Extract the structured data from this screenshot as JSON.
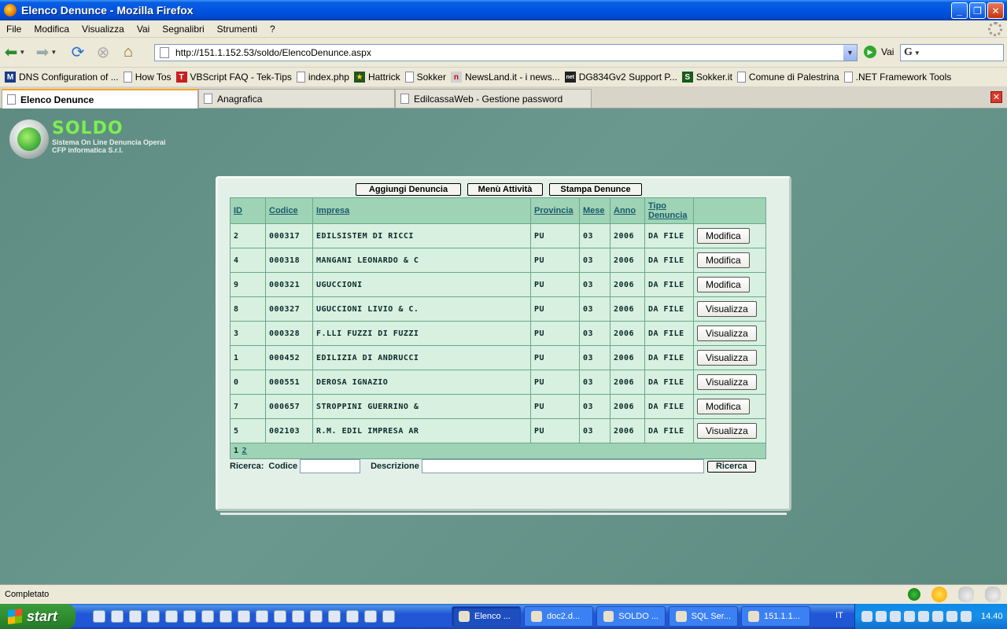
{
  "window": {
    "title": "Elenco Denunce - Mozilla Firefox"
  },
  "menu": [
    "File",
    "Modifica",
    "Visualizza",
    "Vai",
    "Segnalibri",
    "Strumenti",
    "?"
  ],
  "nav": {
    "url": "http://151.1.152.53/soldo/ElencoDenunce.aspx",
    "go_label": "Vai",
    "search_engine_icon": "google-icon"
  },
  "bookmarks": [
    {
      "label": "DNS Configuration of ...",
      "icon": "m"
    },
    {
      "label": "How Tos",
      "icon": "page"
    },
    {
      "label": "VBScript FAQ - Tek-Tips",
      "icon": "red"
    },
    {
      "label": "index.php",
      "icon": "page"
    },
    {
      "label": "Hattrick",
      "icon": "star"
    },
    {
      "label": "Sokker",
      "icon": "page"
    },
    {
      "label": "NewsLand.it - i news...",
      "icon": "nl"
    },
    {
      "label": "DG834Gv2 Support P...",
      "icon": "net"
    },
    {
      "label": "Sokker.it",
      "icon": "s"
    },
    {
      "label": "Comune di Palestrina",
      "icon": "page"
    },
    {
      "label": ".NET Framework Tools",
      "icon": "page"
    }
  ],
  "tabs": [
    {
      "label": "Elenco Denunce",
      "active": true
    },
    {
      "label": "Anagrafica",
      "active": false
    },
    {
      "label": "EdilcassaWeb - Gestione password",
      "active": false
    }
  ],
  "logo": {
    "name": "SOLDO",
    "line1": "Sistema On Line Denuncia Operai",
    "line2": "CFP informatica S.r.l."
  },
  "toolbar": {
    "add": "Aggiungi Denuncia",
    "menu": "Menù Attività",
    "print": "Stampa Denunce"
  },
  "table": {
    "headers": {
      "id": "ID",
      "code": "Codice",
      "company": "Impresa",
      "province": "Provincia",
      "month": "Mese",
      "year": "Anno",
      "type_line1": "Tipo",
      "type_line2": "Denuncia"
    },
    "rows": [
      {
        "id": "2",
        "code": "000317",
        "company": "EDILSISTEM DI RICCI",
        "province": "PU",
        "month": "03",
        "year": "2006",
        "type": "DA FILE",
        "action": "Modifica"
      },
      {
        "id": "4",
        "code": "000318",
        "company": "MANGANI LEONARDO & C",
        "province": "PU",
        "month": "03",
        "year": "2006",
        "type": "DA FILE",
        "action": "Modifica"
      },
      {
        "id": "9",
        "code": "000321",
        "company": "UGUCCIONI",
        "province": "PU",
        "month": "03",
        "year": "2006",
        "type": "DA FILE",
        "action": "Modifica"
      },
      {
        "id": "8",
        "code": "000327",
        "company": "UGUCCIONI LIVIO & C.",
        "province": "PU",
        "month": "03",
        "year": "2006",
        "type": "DA FILE",
        "action": "Visualizza"
      },
      {
        "id": "3",
        "code": "000328",
        "company": "F.LLI FUZZI DI FUZZI",
        "province": "PU",
        "month": "03",
        "year": "2006",
        "type": "DA FILE",
        "action": "Visualizza"
      },
      {
        "id": "1",
        "code": "000452",
        "company": "EDILIZIA DI ANDRUCCI",
        "province": "PU",
        "month": "03",
        "year": "2006",
        "type": "DA FILE",
        "action": "Visualizza"
      },
      {
        "id": "0",
        "code": "000551",
        "company": "DEROSA IGNAZIO",
        "province": "PU",
        "month": "03",
        "year": "2006",
        "type": "DA FILE",
        "action": "Visualizza"
      },
      {
        "id": "7",
        "code": "000657",
        "company": "STROPPINI GUERRINO &",
        "province": "PU",
        "month": "03",
        "year": "2006",
        "type": "DA FILE",
        "action": "Modifica"
      },
      {
        "id": "5",
        "code": "002103",
        "company": "R.M. EDIL IMPRESA AR",
        "province": "PU",
        "month": "03",
        "year": "2006",
        "type": "DA FILE",
        "action": "Visualizza"
      }
    ],
    "pager": {
      "current": "1",
      "next": "2"
    }
  },
  "search": {
    "label": "Ricerca:",
    "code_label": "Codice",
    "desc_label": "Descrizione",
    "code_value": "",
    "desc_value": "",
    "button": "Ricerca"
  },
  "status": {
    "text": "Completato"
  },
  "taskbar": {
    "start": "start",
    "items": [
      {
        "label": "Elenco ...",
        "active": true
      },
      {
        "label": "doc2.d...",
        "active": false
      },
      {
        "label": "SOLDO ...",
        "active": false
      },
      {
        "label": "SQL Ser...",
        "active": false
      },
      {
        "label": "151.1.1...",
        "active": false
      }
    ],
    "lang": "IT",
    "clock": "14.40"
  }
}
